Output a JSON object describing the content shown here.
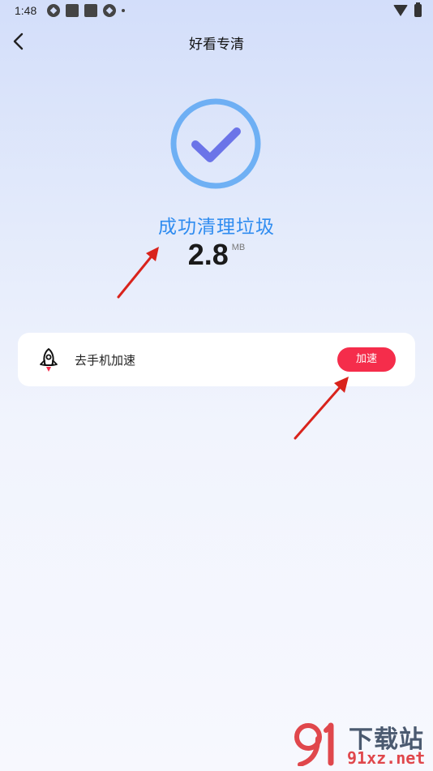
{
  "status_bar": {
    "time": "1:48"
  },
  "header": {
    "title": "好看专清"
  },
  "result": {
    "message": "成功清理垃圾",
    "size": "2.8",
    "unit": "MB"
  },
  "action_card": {
    "label": "去手机加速",
    "button_label": "加速"
  },
  "watermark": {
    "line1": "下载站",
    "line2": "91xz.net"
  },
  "colors": {
    "accent_blue": "#2f8cf0",
    "button_red": "#f52d4b",
    "check_purple": "#6b74e8",
    "arrow_red": "#d9231c"
  }
}
